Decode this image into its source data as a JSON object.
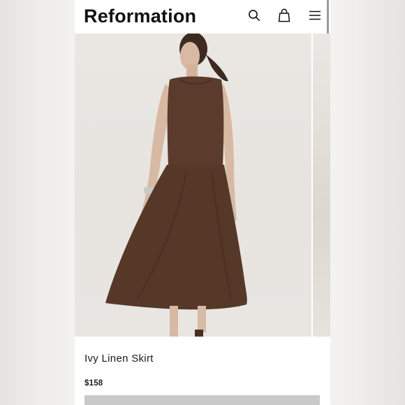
{
  "header": {
    "logo": "Reformation",
    "icons": [
      "search-icon",
      "shopping-bag-icon",
      "hamburger-menu-icon"
    ]
  },
  "product": {
    "name": "Ivy Linen Skirt",
    "price": "$158"
  },
  "colors": {
    "garment": "#5a3b2c",
    "photo_background": "#e8e5e1",
    "button": "#c9c9c9"
  }
}
